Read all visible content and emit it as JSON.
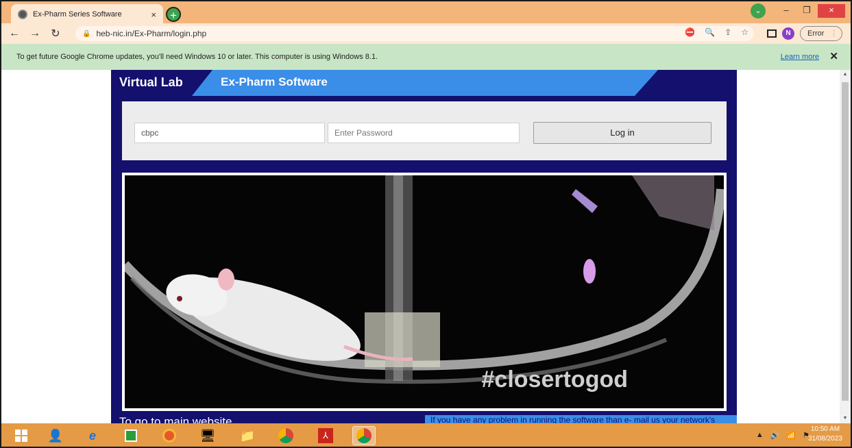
{
  "browser": {
    "tab_title": "Ex-Pharm Series Software",
    "tab_close": "×",
    "new_tab": "+",
    "url": "heb-nic.in/Ex-Pharm/login.php",
    "profile_initial": "N",
    "error_label": "Error",
    "window_buttons": {
      "minimize": "–",
      "restore": "❐",
      "close": "×"
    }
  },
  "infobar": {
    "message": "To get future Google Chrome updates, you'll need Windows 10 or later. This computer is using Windows 8.1.",
    "learn_more": "Learn more",
    "close": "✕"
  },
  "site": {
    "brand": "Virtual Lab",
    "title": "Ex-Pharm Software",
    "login": {
      "username_value": "cbpc",
      "password_placeholder": "Enter Password",
      "button_label": "Log in"
    },
    "hero_hashtag": "#closertogod",
    "footer_left": "To go to main website",
    "footer_right": "If you have any problem in running the software than e- mail us your network's"
  },
  "taskbar": {
    "time": "10:50 AM",
    "date": "31/08/2023"
  }
}
